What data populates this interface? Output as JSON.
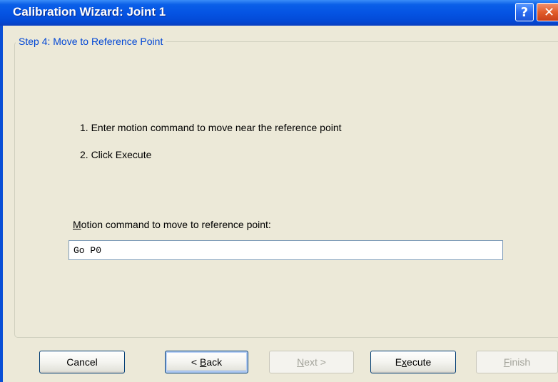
{
  "window": {
    "title": "Calibration Wizard: Joint 1",
    "help_glyph": "?",
    "close_glyph": "✕"
  },
  "step": {
    "title": "Step 4: Move to Reference Point"
  },
  "instructions": [
    "1. Enter motion command to move near the reference point",
    "2. Click Execute"
  ],
  "motion_field": {
    "label_mnemonic": "M",
    "label_rest": "otion command to move to reference point:",
    "value": "Go P0"
  },
  "buttons": {
    "cancel": {
      "label": "Cancel",
      "enabled": true
    },
    "back": {
      "label_prefix": "< ",
      "label_mnemonic": "B",
      "label_rest": "ack",
      "enabled": true,
      "focused": true
    },
    "next": {
      "label_mnemonic": "N",
      "label_rest": "ext >",
      "enabled": false
    },
    "execute": {
      "label_prefix": "E",
      "label_mnemonic": "x",
      "label_rest": "ecute",
      "enabled": true
    },
    "finish": {
      "label_mnemonic": "F",
      "label_rest": "inish",
      "enabled": false
    }
  },
  "colors": {
    "titlebar": "#0554e3",
    "dialog_bg": "#ece9d8",
    "legend_text": "#0046d5"
  }
}
